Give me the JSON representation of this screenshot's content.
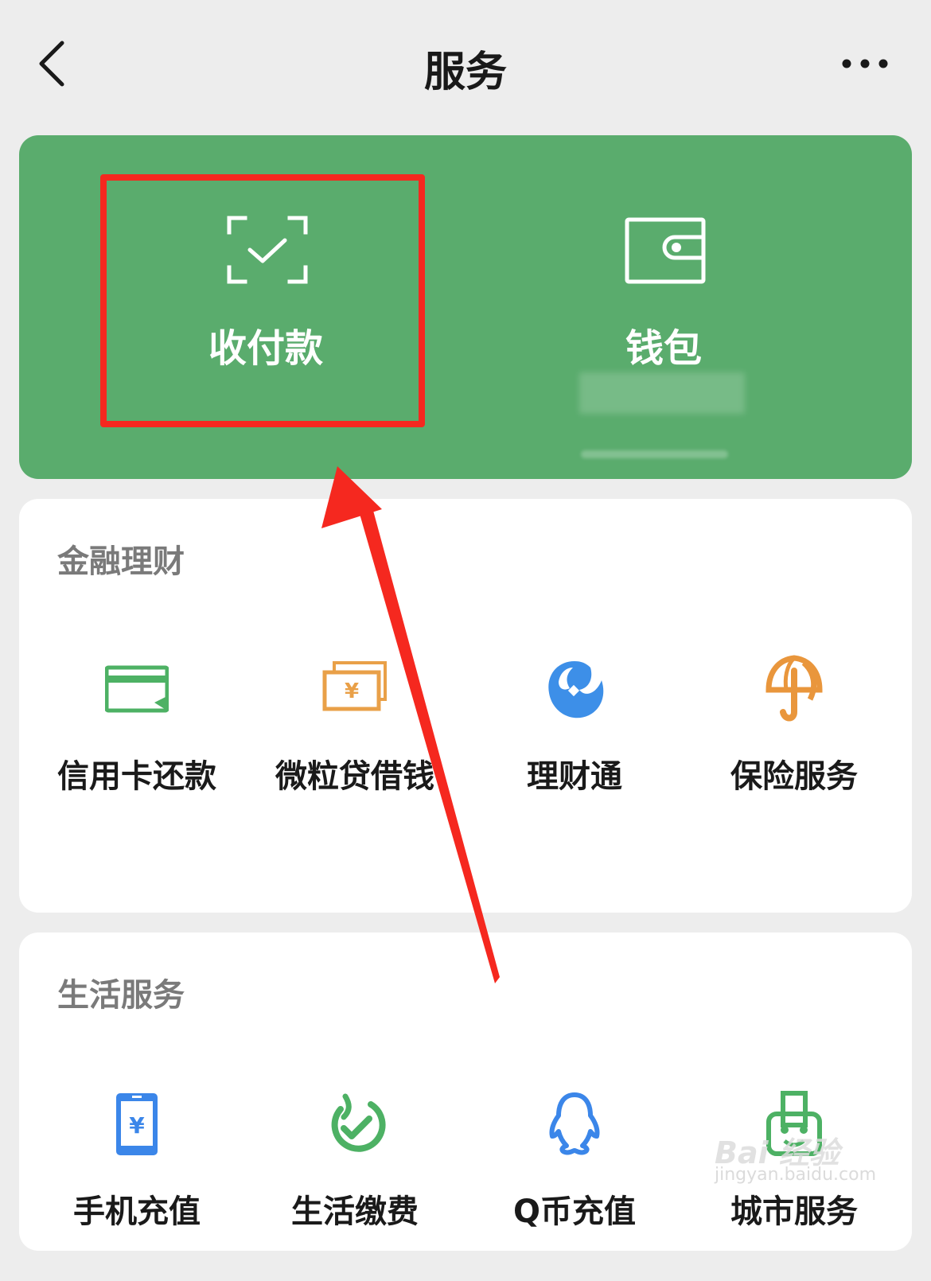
{
  "nav": {
    "title": "服务"
  },
  "pay_card": {
    "items": [
      {
        "label": "收付款",
        "icon": "scan-check-icon"
      },
      {
        "label": "钱包",
        "icon": "wallet-icon"
      }
    ]
  },
  "finance": {
    "title": "金融理财",
    "items": [
      {
        "label": "信用卡还款",
        "icon": "credit-card-icon"
      },
      {
        "label": "微粒贷借钱",
        "icon": "banknote-icon"
      },
      {
        "label": "理财通",
        "icon": "licaitong-icon"
      },
      {
        "label": "保险服务",
        "icon": "umbrella-icon"
      }
    ]
  },
  "life": {
    "title": "生活服务",
    "items": [
      {
        "label": "手机充值",
        "icon": "phone-recharge-icon"
      },
      {
        "label": "生活缴费",
        "icon": "bill-payment-icon"
      },
      {
        "label": "Q币充值",
        "icon": "qq-penguin-icon"
      },
      {
        "label": "城市服务",
        "icon": "city-service-icon"
      }
    ]
  },
  "watermark": {
    "brand": "Bai 经验",
    "url": "jingyan.baidu.com"
  },
  "colors": {
    "brand_green": "#5aac6d",
    "annotation_red": "#f5281f",
    "background": "#ededed"
  }
}
